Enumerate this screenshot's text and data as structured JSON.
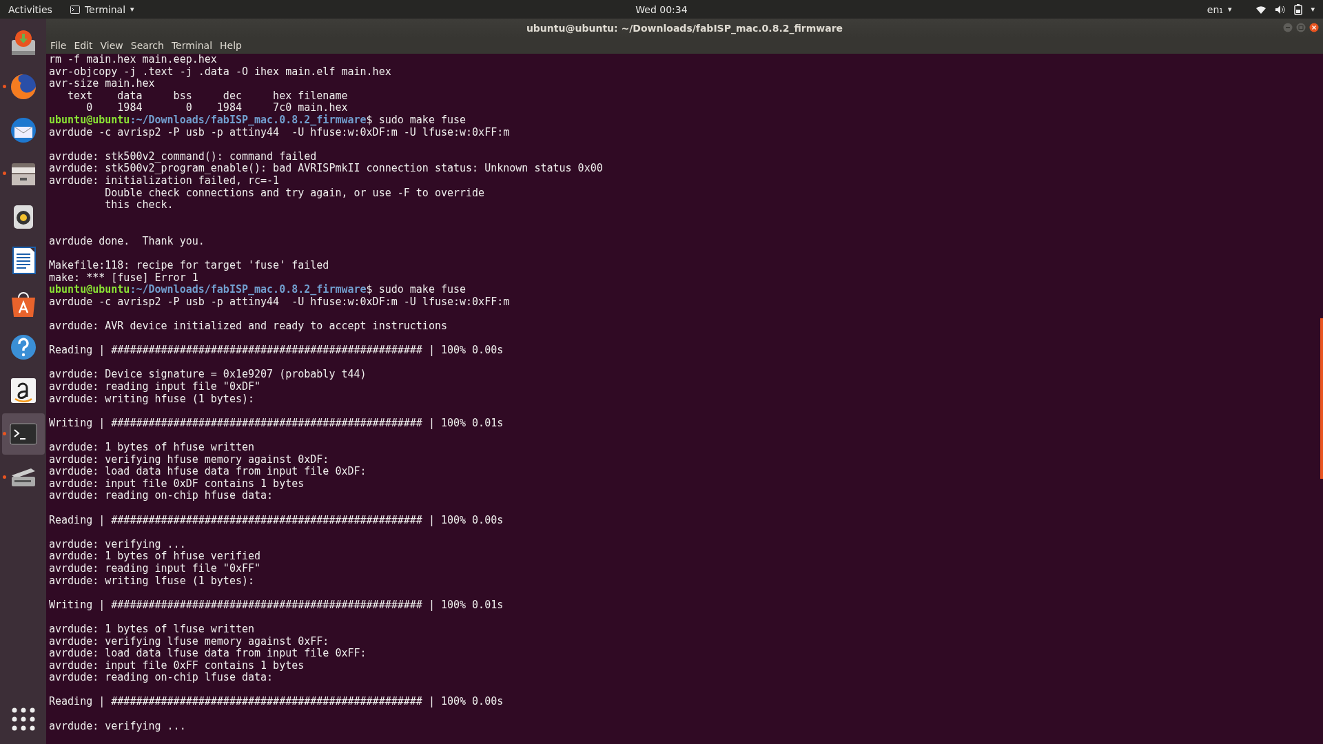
{
  "top_bar": {
    "activities": "Activities",
    "app_menu": "Terminal",
    "app_caret": "▾",
    "clock": "Wed 00:34",
    "input_source": "en₁",
    "input_caret": "▾",
    "system_caret": "▾"
  },
  "dock": {
    "items": [
      {
        "kind": "installer",
        "running": false,
        "selected": false
      },
      {
        "kind": "browser",
        "running": true,
        "selected": false
      },
      {
        "kind": "mail",
        "running": false,
        "selected": false
      },
      {
        "kind": "files",
        "running": true,
        "selected": false
      },
      {
        "kind": "music",
        "running": false,
        "selected": false
      },
      {
        "kind": "writer",
        "running": false,
        "selected": false
      },
      {
        "kind": "store",
        "running": false,
        "selected": false
      },
      {
        "kind": "help",
        "running": false,
        "selected": false
      },
      {
        "kind": "amazon",
        "running": false,
        "selected": false
      },
      {
        "kind": "terminal",
        "running": true,
        "selected": true
      },
      {
        "kind": "scanner",
        "running": true,
        "selected": false
      }
    ]
  },
  "window": {
    "title": "ubuntu@ubuntu: ~/Downloads/fabISP_mac.0.8.2_firmware"
  },
  "menu": [
    "File",
    "Edit",
    "View",
    "Search",
    "Terminal",
    "Help"
  ],
  "terminal": {
    "lines": [
      {
        "kind": "output",
        "text": "rm -f main.hex main.eep.hex"
      },
      {
        "kind": "output",
        "text": "avr-objcopy -j .text -j .data -O ihex main.elf main.hex"
      },
      {
        "kind": "output",
        "text": "avr-size main.hex"
      },
      {
        "kind": "output",
        "text": "   text    data     bss     dec     hex filename"
      },
      {
        "kind": "output",
        "text": "      0    1984       0    1984     7c0 main.hex"
      },
      {
        "kind": "prompt",
        "user": "ubuntu@ubuntu",
        "path": ":~/Downloads/fabISP_mac.0.8.2_firmware",
        "command": "$ sudo make fuse"
      },
      {
        "kind": "output",
        "text": "avrdude -c avrisp2 -P usb -p attiny44  -U hfuse:w:0xDF:m -U lfuse:w:0xFF:m"
      },
      {
        "kind": "blank"
      },
      {
        "kind": "output",
        "text": "avrdude: stk500v2_command(): command failed"
      },
      {
        "kind": "output",
        "text": "avrdude: stk500v2_program_enable(): bad AVRISPmkII connection status: Unknown status 0x00"
      },
      {
        "kind": "output",
        "text": "avrdude: initialization failed, rc=-1"
      },
      {
        "kind": "output",
        "text": "         Double check connections and try again, or use -F to override"
      },
      {
        "kind": "output",
        "text": "         this check."
      },
      {
        "kind": "blank"
      },
      {
        "kind": "blank"
      },
      {
        "kind": "output",
        "text": "avrdude done.  Thank you."
      },
      {
        "kind": "blank"
      },
      {
        "kind": "output",
        "text": "Makefile:118: recipe for target 'fuse' failed"
      },
      {
        "kind": "output",
        "text": "make: *** [fuse] Error 1"
      },
      {
        "kind": "prompt",
        "user": "ubuntu@ubuntu",
        "path": ":~/Downloads/fabISP_mac.0.8.2_firmware",
        "command": "$ sudo make fuse"
      },
      {
        "kind": "output",
        "text": "avrdude -c avrisp2 -P usb -p attiny44  -U hfuse:w:0xDF:m -U lfuse:w:0xFF:m"
      },
      {
        "kind": "blank"
      },
      {
        "kind": "output",
        "text": "avrdude: AVR device initialized and ready to accept instructions"
      },
      {
        "kind": "blank"
      },
      {
        "kind": "output",
        "text": "Reading | ################################################## | 100% 0.00s"
      },
      {
        "kind": "blank"
      },
      {
        "kind": "output",
        "text": "avrdude: Device signature = 0x1e9207 (probably t44)"
      },
      {
        "kind": "output",
        "text": "avrdude: reading input file \"0xDF\""
      },
      {
        "kind": "output",
        "text": "avrdude: writing hfuse (1 bytes):"
      },
      {
        "kind": "blank"
      },
      {
        "kind": "output",
        "text": "Writing | ################################################## | 100% 0.01s"
      },
      {
        "kind": "blank"
      },
      {
        "kind": "output",
        "text": "avrdude: 1 bytes of hfuse written"
      },
      {
        "kind": "output",
        "text": "avrdude: verifying hfuse memory against 0xDF:"
      },
      {
        "kind": "output",
        "text": "avrdude: load data hfuse data from input file 0xDF:"
      },
      {
        "kind": "output",
        "text": "avrdude: input file 0xDF contains 1 bytes"
      },
      {
        "kind": "output",
        "text": "avrdude: reading on-chip hfuse data:"
      },
      {
        "kind": "blank"
      },
      {
        "kind": "output",
        "text": "Reading | ################################################## | 100% 0.00s"
      },
      {
        "kind": "blank"
      },
      {
        "kind": "output",
        "text": "avrdude: verifying ..."
      },
      {
        "kind": "output",
        "text": "avrdude: 1 bytes of hfuse verified"
      },
      {
        "kind": "output",
        "text": "avrdude: reading input file \"0xFF\""
      },
      {
        "kind": "output",
        "text": "avrdude: writing lfuse (1 bytes):"
      },
      {
        "kind": "blank"
      },
      {
        "kind": "output",
        "text": "Writing | ################################################## | 100% 0.01s"
      },
      {
        "kind": "blank"
      },
      {
        "kind": "output",
        "text": "avrdude: 1 bytes of lfuse written"
      },
      {
        "kind": "output",
        "text": "avrdude: verifying lfuse memory against 0xFF:"
      },
      {
        "kind": "output",
        "text": "avrdude: load data lfuse data from input file 0xFF:"
      },
      {
        "kind": "output",
        "text": "avrdude: input file 0xFF contains 1 bytes"
      },
      {
        "kind": "output",
        "text": "avrdude: reading on-chip lfuse data:"
      },
      {
        "kind": "blank"
      },
      {
        "kind": "output",
        "text": "Reading | ################################################## | 100% 0.00s"
      },
      {
        "kind": "blank"
      },
      {
        "kind": "output",
        "text": "avrdude: verifying ..."
      }
    ]
  }
}
